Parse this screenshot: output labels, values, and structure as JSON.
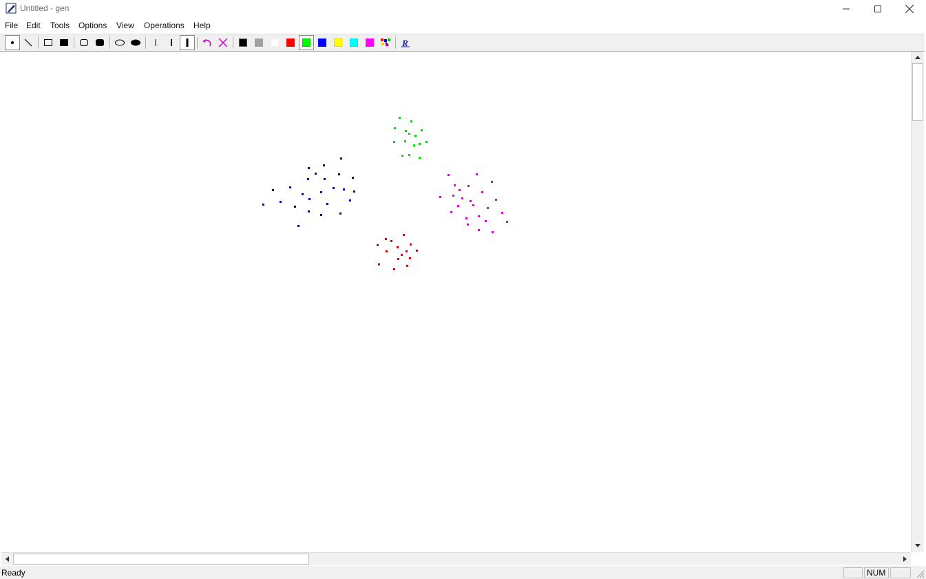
{
  "window": {
    "title": "Untitled - gen"
  },
  "menu": [
    "File",
    "Edit",
    "Tools",
    "Options",
    "View",
    "Operations",
    "Help"
  ],
  "toolbar": {
    "tools": [
      {
        "name": "point-tool",
        "icon": "dot-icon",
        "pressed": true
      },
      {
        "name": "line-tool",
        "icon": "line-icon",
        "pressed": false
      },
      {
        "name": "rectangle-tool",
        "icon": "rect-outline-icon",
        "pressed": false
      },
      {
        "name": "filled-rectangle-tool",
        "icon": "rect-filled-icon",
        "pressed": false
      },
      {
        "name": "rounded-rectangle-tool",
        "icon": "roundrect-outline-icon",
        "pressed": false
      },
      {
        "name": "filled-rounded-rectangle-tool",
        "icon": "roundrect-filled-icon",
        "pressed": false
      },
      {
        "name": "ellipse-tool",
        "icon": "ellipse-outline-icon",
        "pressed": false
      },
      {
        "name": "filled-ellipse-tool",
        "icon": "ellipse-filled-icon",
        "pressed": false
      },
      {
        "name": "thin-width-tool",
        "icon": "thin-line-icon",
        "pressed": false
      },
      {
        "name": "medium-width-tool",
        "icon": "medium-line-icon",
        "pressed": false
      },
      {
        "name": "thick-width-tool",
        "icon": "thick-line-icon",
        "pressed": true
      },
      {
        "name": "undo-tool",
        "icon": "undo-icon",
        "pressed": false
      },
      {
        "name": "clear-tool",
        "icon": "x-icon",
        "pressed": false
      }
    ],
    "colors": [
      {
        "name": "black",
        "hex": "#000000",
        "pressed": false
      },
      {
        "name": "gray",
        "hex": "#a0a0a0",
        "pressed": false
      },
      {
        "name": "white",
        "hex": "#ffffff",
        "pressed": false
      },
      {
        "name": "red",
        "hex": "#ff0000",
        "pressed": false
      },
      {
        "name": "green",
        "hex": "#00ff00",
        "pressed": true
      },
      {
        "name": "blue",
        "hex": "#0000ff",
        "pressed": false
      },
      {
        "name": "yellow",
        "hex": "#ffff00",
        "pressed": false
      },
      {
        "name": "cyan",
        "hex": "#00ffff",
        "pressed": false
      },
      {
        "name": "magenta",
        "hex": "#ff00ff",
        "pressed": false
      }
    ],
    "extra": [
      {
        "name": "random-color-tool",
        "icon": "multicolor-icon"
      },
      {
        "name": "random-generate-tool",
        "icon": "r-icon"
      }
    ]
  },
  "canvas": {
    "point_clusters": [
      {
        "color": "#00e000",
        "count": 15
      },
      {
        "color": "#0000c0",
        "count": 25
      },
      {
        "color": "#e000e0",
        "count": 24
      },
      {
        "color": "#e00000",
        "count": 15
      }
    ]
  },
  "status": {
    "text": "Ready",
    "indicators": [
      "",
      "NUM",
      ""
    ]
  }
}
